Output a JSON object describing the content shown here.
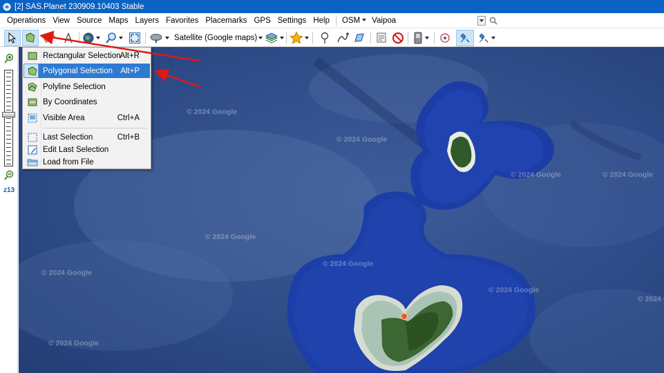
{
  "window": {
    "title": "[2] SAS.Planet 230909.10403 Stable"
  },
  "menubar": {
    "items": [
      "Operations",
      "View",
      "Source",
      "Maps",
      "Layers",
      "Favorites",
      "Placemarks",
      "GPS",
      "Settings",
      "Help"
    ],
    "geocoder": "OSM",
    "search_value": "Vaipoa"
  },
  "toolbar": {
    "map_type_label": "Satellite (Google maps)"
  },
  "selection_menu": {
    "items": [
      {
        "label": "Rectangular Selection",
        "shortcut": "Alt+R",
        "icon": "rectangular-selection-icon"
      },
      {
        "label": "Polygonal Selection",
        "shortcut": "Alt+P",
        "icon": "polygonal-selection-icon",
        "highlighted": true
      },
      {
        "label": "Polyline Selection",
        "shortcut": "",
        "icon": "polyline-selection-icon"
      },
      {
        "label": "By Coordinates",
        "shortcut": "",
        "icon": "coordinates-selection-icon"
      },
      {
        "label": "Visible Area",
        "shortcut": "Ctrl+A",
        "icon": "visible-area-icon"
      },
      {
        "label": "Last Selection",
        "shortcut": "Ctrl+B",
        "icon": "last-selection-icon"
      },
      {
        "label": "Edit Last Selection",
        "shortcut": "",
        "icon": "edit-selection-icon"
      },
      {
        "label": "Load from File",
        "shortcut": "",
        "icon": "folder-icon"
      }
    ]
  },
  "zoom": {
    "level_label": "z13"
  },
  "map": {
    "watermark": "© 2024 Google"
  },
  "colors": {
    "titlebar": "#0a62c4",
    "menu_highlight": "#2e7ad1",
    "annotation_arrow": "#e01818",
    "ocean": "#2c4a86",
    "reef": "#1b3fa6"
  }
}
